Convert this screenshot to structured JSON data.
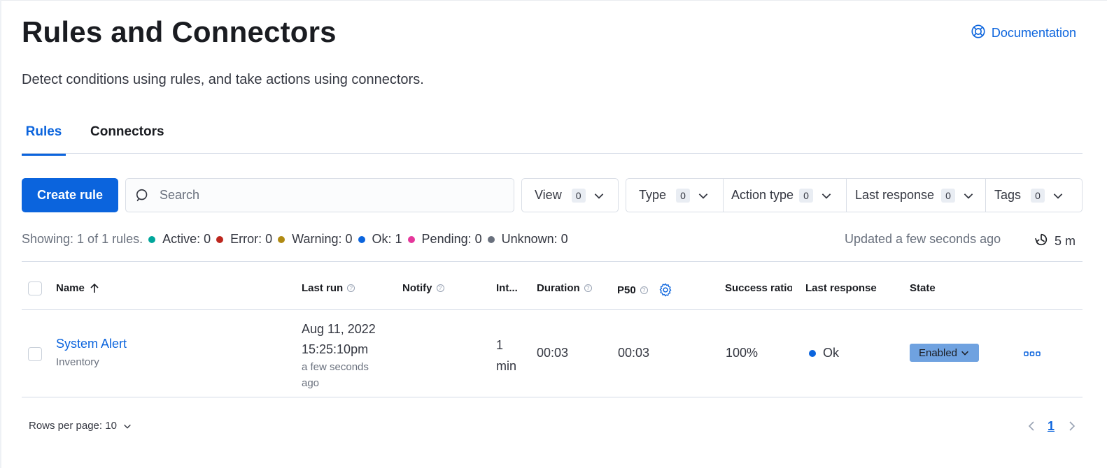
{
  "header": {
    "title": "Rules and Connectors",
    "subtitle": "Detect conditions using rules, and take actions using connectors.",
    "doc_link": "Documentation"
  },
  "tabs": [
    {
      "label": "Rules",
      "active": true
    },
    {
      "label": "Connectors",
      "active": false
    }
  ],
  "toolbar": {
    "create_label": "Create rule",
    "search_placeholder": "Search",
    "filters": [
      {
        "label": "View",
        "count": "0"
      },
      {
        "label": "Type",
        "count": "0"
      },
      {
        "label": "Action type",
        "count": "0"
      },
      {
        "label": "Last response",
        "count": "0"
      },
      {
        "label": "Tags",
        "count": "0"
      }
    ]
  },
  "stats": {
    "showing": "Showing: 1 of 1 rules.",
    "items": [
      {
        "label": "Active: 0",
        "color": "#00a69b"
      },
      {
        "label": "Error: 0",
        "color": "#bd271e"
      },
      {
        "label": "Warning: 0",
        "color": "#b08a12"
      },
      {
        "label": "Ok: 1",
        "color": "#0b64dd"
      },
      {
        "label": "Pending: 0",
        "color": "#e5379b"
      },
      {
        "label": "Unknown: 0",
        "color": "#69707d"
      }
    ],
    "updated": "Updated a few seconds ago",
    "refresh_interval": "5 m"
  },
  "table": {
    "columns": [
      "Name",
      "Last run",
      "Notify",
      "Int...",
      "Duration",
      "P50",
      "Success ratio",
      "Last response",
      "State"
    ],
    "rows": [
      {
        "name": "System Alert",
        "type": "Inventory",
        "last_run_date": "Aug 11, 2022",
        "last_run_time": "15:25:10pm",
        "last_run_relative": "a few seconds ago",
        "interval_num": "1",
        "interval_unit": "min",
        "duration": "00:03",
        "p50": "00:03",
        "success_ratio": "100%",
        "last_response": "Ok",
        "last_response_color": "#0b64dd",
        "state": "Enabled"
      }
    ]
  },
  "pagination": {
    "rows_per_page": "Rows per page: 10",
    "current_page": "1"
  }
}
